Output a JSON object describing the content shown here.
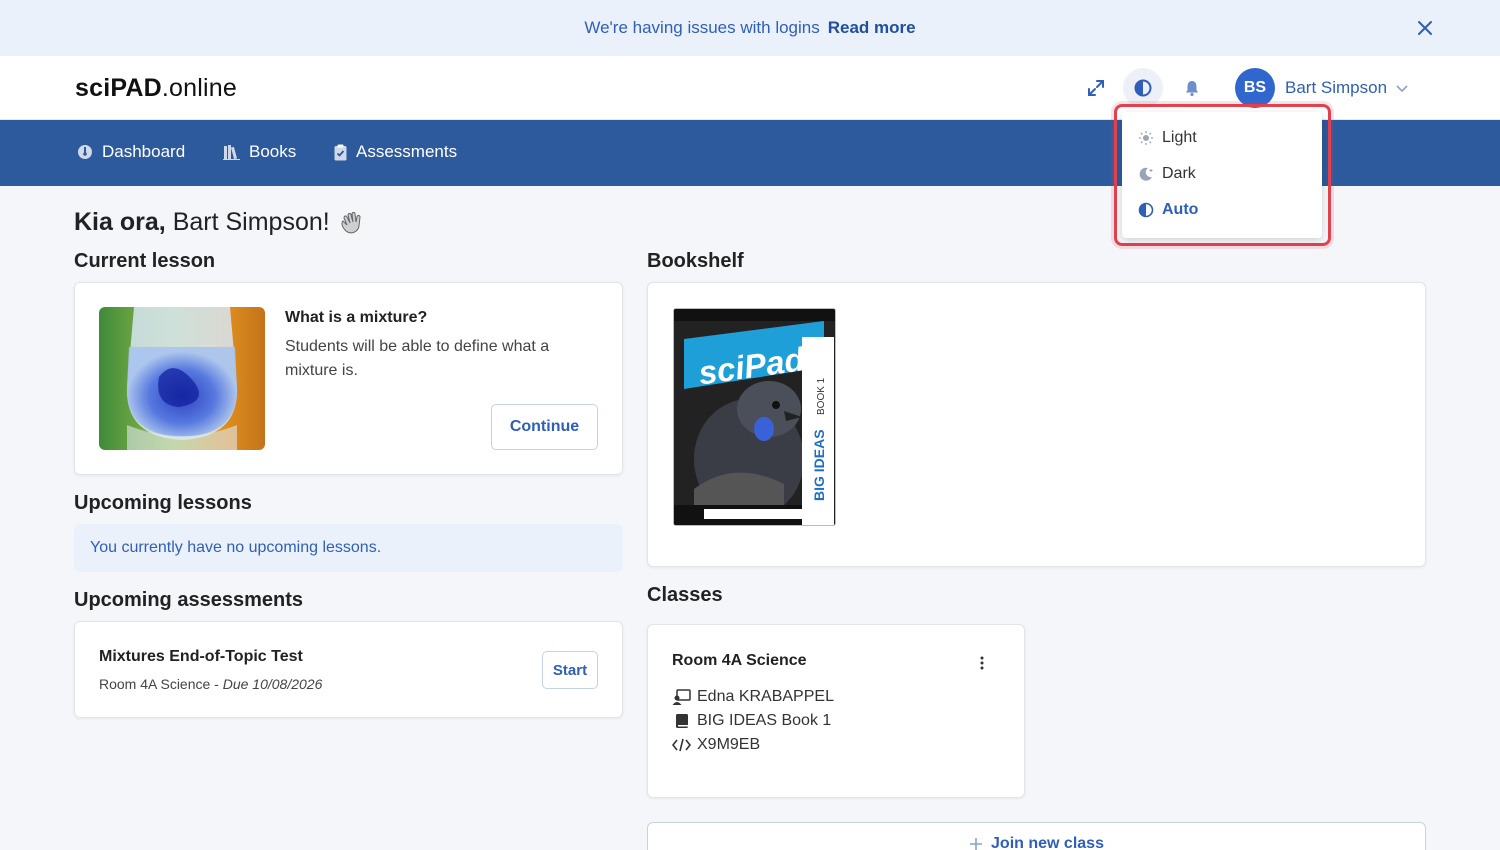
{
  "banner": {
    "message": "We're having issues with logins",
    "link": "Read more"
  },
  "header": {
    "logo_bold": "sciPAD",
    "logo_rest": ".online",
    "avatar_initials": "BS",
    "user_name": "Bart Simpson"
  },
  "nav": {
    "items": [
      {
        "label": "Dashboard"
      },
      {
        "label": "Books"
      },
      {
        "label": "Assessments"
      }
    ]
  },
  "greeting": {
    "salutation": "Kia ora,",
    "name": "Bart Simpson!"
  },
  "current_lesson": {
    "heading": "Current lesson",
    "title": "What is a mixture?",
    "description": "Students will be able to define what a mixture is.",
    "button": "Continue"
  },
  "upcoming_lessons": {
    "heading": "Upcoming lessons",
    "message": "You currently have no upcoming lessons."
  },
  "upcoming_assessments": {
    "heading": "Upcoming assessments",
    "items": [
      {
        "title": "Mixtures End-of-Topic Test",
        "class": "Room 4A Science - ",
        "due": "Due 10/08/2026",
        "button": "Start"
      }
    ]
  },
  "bookshelf": {
    "heading": "Bookshelf",
    "book": {
      "brand": "sciPad",
      "series": "BIG IDEAS",
      "volume": "BOOK 1"
    }
  },
  "classes": {
    "heading": "Classes",
    "items": [
      {
        "name": "Room 4A Science",
        "teacher": "Edna KRABAPPEL",
        "book": "BIG IDEAS Book 1",
        "code": "X9M9EB"
      }
    ],
    "join_label": "Join new class"
  },
  "theme_menu": {
    "options": [
      {
        "label": "Light"
      },
      {
        "label": "Dark"
      },
      {
        "label": "Auto"
      }
    ],
    "selected": "Auto"
  },
  "colors": {
    "brand_blue": "#2f5fb8",
    "nav_bg": "#2d5a9c",
    "highlight_red": "#e0424f"
  }
}
